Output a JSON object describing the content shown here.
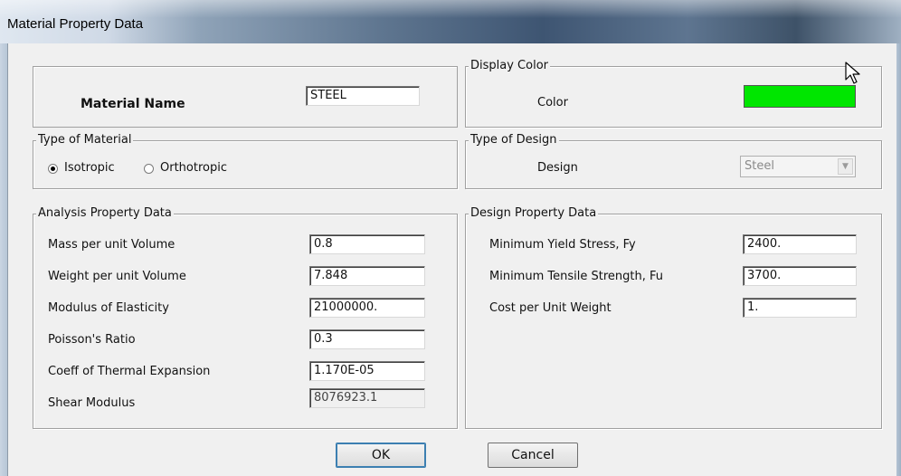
{
  "window": {
    "title": "Material Property Data"
  },
  "material_name": {
    "label": "Material Name",
    "value": "STEEL"
  },
  "display_color": {
    "legend": "Display Color",
    "label": "Color",
    "swatch_color": "#00e600"
  },
  "type_of_material": {
    "legend": "Type of Material",
    "options": [
      {
        "label": "Isotropic",
        "selected": true
      },
      {
        "label": "Orthotropic",
        "selected": false
      }
    ]
  },
  "type_of_design": {
    "legend": "Type of Design",
    "label": "Design",
    "value": "Steel"
  },
  "analysis": {
    "legend": "Analysis Property Data",
    "rows": [
      {
        "label": "Mass per unit Volume",
        "value": "0.8"
      },
      {
        "label": "Weight per unit Volume",
        "value": "7.848"
      },
      {
        "label": "Modulus of Elasticity",
        "value": "21000000."
      },
      {
        "label": "Poisson's Ratio",
        "value": "0.3"
      },
      {
        "label": "Coeff of Thermal Expansion",
        "value": "1.170E-05"
      },
      {
        "label": "Shear Modulus",
        "value": "8076923.1"
      }
    ]
  },
  "design": {
    "legend": "Design Property Data",
    "rows": [
      {
        "label": "Minimum Yield Stress, Fy",
        "value": "2400."
      },
      {
        "label": "Minimum Tensile Strength, Fu",
        "value": "3700."
      },
      {
        "label": "Cost per Unit Weight",
        "value": "1."
      }
    ]
  },
  "buttons": {
    "ok": "OK",
    "cancel": "Cancel"
  },
  "icons": {
    "radio_on": "radio-selected-icon",
    "radio_off": "radio-unselected-icon",
    "dropdown": "chevron-down-icon",
    "cursor": "mouse-pointer-icon"
  }
}
